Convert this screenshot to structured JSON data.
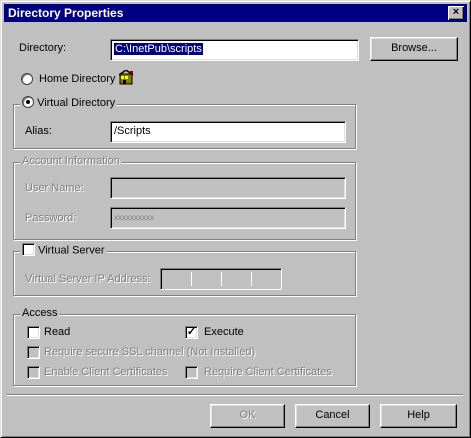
{
  "window": {
    "title": "Directory Properties",
    "close_glyph": "×"
  },
  "directory": {
    "label": "Directory:",
    "value": "C:\\InetPub\\scripts",
    "browse_label": "Browse..."
  },
  "home_directory": {
    "label": "Home Directory",
    "selected": false
  },
  "virtual_directory": {
    "label": "Virtual Directory",
    "selected": true,
    "alias_label": "Alias:",
    "alias_value": "/Scripts"
  },
  "account": {
    "legend": "Account Information",
    "user_label": "User Name:",
    "user_value": "",
    "password_label": "Password:",
    "password_value": "xxxxxxxxxx"
  },
  "virtual_server": {
    "label": "Virtual Server",
    "checked": false,
    "ip_label": "Virtual Server IP Address:"
  },
  "access": {
    "legend": "Access",
    "read_label": "Read",
    "read_checked": false,
    "execute_label": "Execute",
    "execute_checked": true,
    "ssl_label": "Require secure SSL channel (Not Installed)",
    "enable_certs_label": "Enable Client Certificates",
    "require_certs_label": "Require Client Certificates"
  },
  "buttons": {
    "ok": "OK",
    "cancel": "Cancel",
    "help": "Help"
  },
  "icons": {
    "home": "home-directory-icon"
  }
}
